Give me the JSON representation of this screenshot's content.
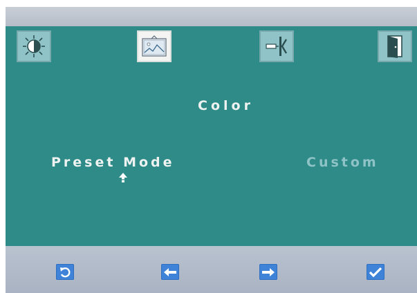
{
  "colors": {
    "panel": "#2f8b87",
    "tab_inactive": "#8fc3c7",
    "tab_active": "#f4f4f2",
    "text": "#eef3f2",
    "value_text": "#8fc3c7",
    "button": "#3f83d8"
  },
  "tabs": [
    {
      "name": "brightness",
      "icon": "brightness-sun-icon",
      "selected": false
    },
    {
      "name": "color",
      "icon": "picture-color-icon",
      "selected": true
    },
    {
      "name": "input",
      "icon": "input-source-icon",
      "selected": false
    },
    {
      "name": "exit",
      "icon": "exit-door-icon",
      "selected": false
    }
  ],
  "menu": {
    "title": "Color",
    "item_label": "Preset Mode",
    "item_value": "Custom"
  },
  "buttons": [
    {
      "name": "back",
      "icon": "rotate-back-icon"
    },
    {
      "name": "left",
      "icon": "arrow-left-icon"
    },
    {
      "name": "right",
      "icon": "arrow-right-icon"
    },
    {
      "name": "ok",
      "icon": "checkmark-icon"
    }
  ]
}
